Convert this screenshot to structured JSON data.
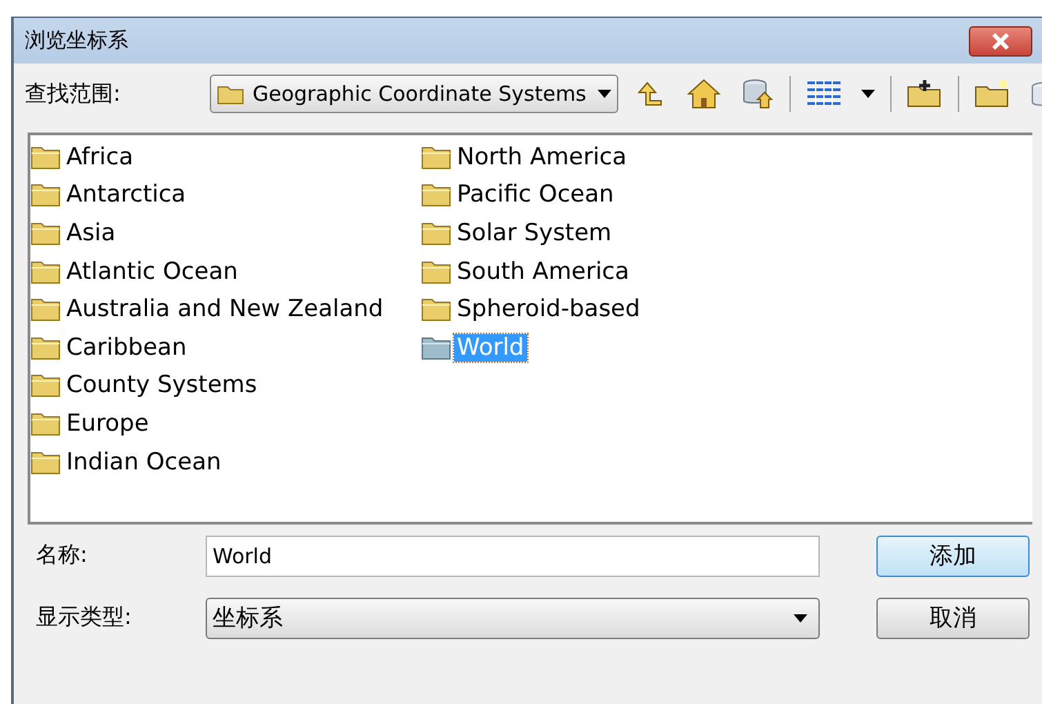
{
  "window": {
    "title": "浏览坐标系"
  },
  "look_in": {
    "label": "查找范围:",
    "value": "Geographic Coordinate Systems"
  },
  "items": [
    {
      "label": "Africa",
      "selected": false
    },
    {
      "label": "Antarctica",
      "selected": false
    },
    {
      "label": "Asia",
      "selected": false
    },
    {
      "label": "Atlantic Ocean",
      "selected": false
    },
    {
      "label": "Australia and New Zealand",
      "selected": false
    },
    {
      "label": "Caribbean",
      "selected": false
    },
    {
      "label": "County Systems",
      "selected": false
    },
    {
      "label": "Europe",
      "selected": false
    },
    {
      "label": "Indian Ocean",
      "selected": false
    },
    {
      "label": "North America",
      "selected": false
    },
    {
      "label": "Pacific Ocean",
      "selected": false
    },
    {
      "label": "Solar System",
      "selected": false
    },
    {
      "label": "South America",
      "selected": false
    },
    {
      "label": "Spheroid-based",
      "selected": false
    },
    {
      "label": "World",
      "selected": true
    }
  ],
  "name_field": {
    "label": "名称:",
    "value": "World"
  },
  "type_field": {
    "label": "显示类型:",
    "value": "坐标系"
  },
  "buttons": [
    {
      "label": "添加",
      "kind": "default"
    },
    {
      "label": "取消",
      "kind": "normal"
    }
  ]
}
